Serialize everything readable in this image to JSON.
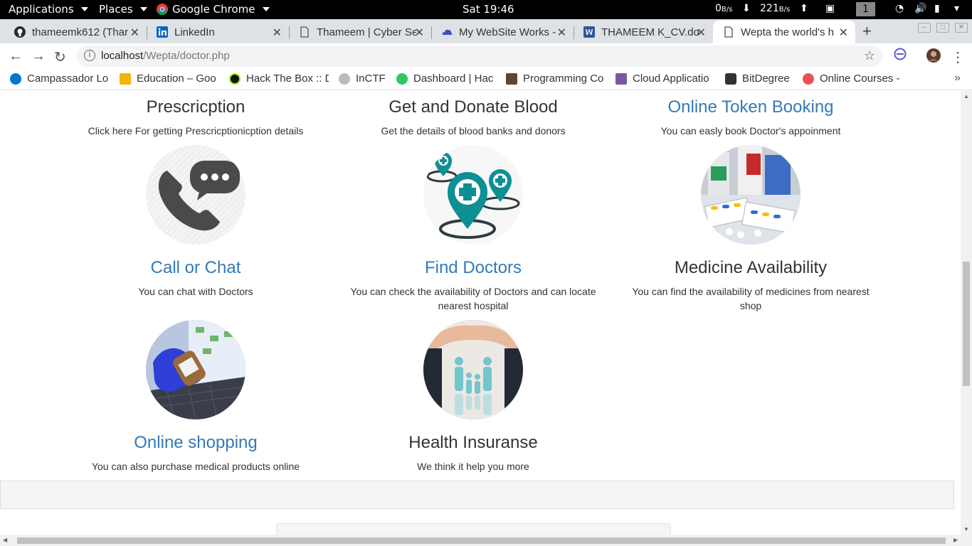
{
  "topbar": {
    "applications": "Applications",
    "places": "Places",
    "browser": "Google Chrome",
    "clock": "Sat 19:46",
    "net_down": "0",
    "net_down_unit": "B/s",
    "net_up": "221",
    "net_up_unit": "B/s",
    "workspace": "1"
  },
  "tabs": [
    {
      "label": "thameemk612 (Thar",
      "icon": "github-icon"
    },
    {
      "label": "LinkedIn",
      "icon": "linkedin-icon"
    },
    {
      "label": "Thameem | Cyber Se",
      "icon": "page-icon"
    },
    {
      "label": "My WebSite Works -",
      "icon": "onedrive-icon"
    },
    {
      "label": "THAMEEM K_CV.do",
      "icon": "word-icon"
    },
    {
      "label": "Wepta the world's h",
      "icon": "page-icon",
      "active": true
    }
  ],
  "address": {
    "host": "localhost",
    "path": "/Wepta/doctor.php"
  },
  "bookmarks": [
    {
      "label": "Campassador Lo",
      "icon": "dell-icon",
      "color": "#0076ce"
    },
    {
      "label": "Education – Goo",
      "icon": "google-edu-icon",
      "color": "#f4b400"
    },
    {
      "label": "Hack The Box :: D",
      "icon": "htb-icon",
      "color": "#111111"
    },
    {
      "label": "InCTF",
      "icon": "inctf-icon",
      "color": "#999999"
    },
    {
      "label": "Dashboard | Hac",
      "icon": "hackerrank-icon",
      "color": "#2ec866"
    },
    {
      "label": "Programming Co",
      "icon": "codechef-icon",
      "color": "#5b4638"
    },
    {
      "label": "Cloud Applicatio",
      "icon": "heroku-icon",
      "color": "#79589f"
    },
    {
      "label": "BitDegree",
      "icon": "bitdegree-icon",
      "color": "#333333"
    },
    {
      "label": "Online Courses -",
      "icon": "udemy-icon",
      "color": "#ec5252"
    }
  ],
  "services": [
    {
      "title": "Prescricption",
      "desc": "Click here For getting Prescricptionicption details",
      "link": false
    },
    {
      "title": "Get and Donate Blood",
      "desc": "Get the details of blood banks and donors",
      "link": false
    },
    {
      "title": "Online Token Booking",
      "desc": "You can easly book Doctor's appoinment",
      "link": true
    },
    {
      "title": "Call or Chat",
      "desc": "You can chat with Doctors",
      "link": true
    },
    {
      "title": "Find Doctors",
      "desc": "You can check the availability of Doctors and can locate nearest hospital",
      "link": true
    },
    {
      "title": "Medicine Availability",
      "desc": "You can find the availability of medicines from nearest shop",
      "link": false
    },
    {
      "title": "Online shopping",
      "desc": "You can also purchase medical products online",
      "link": true
    },
    {
      "title": "Health Insuranse",
      "desc": "We think it help you more",
      "link": false
    }
  ],
  "colors": {
    "link": "#337ab7",
    "teal": "#0e8f94",
    "phone": "#4a4a4a"
  }
}
